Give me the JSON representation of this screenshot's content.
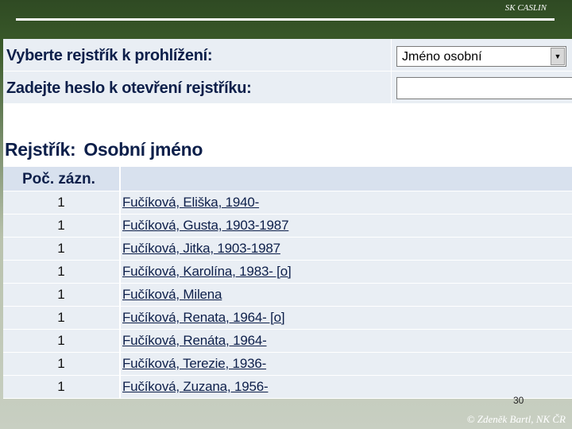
{
  "header": {
    "tag": "SK CASLIN"
  },
  "form": {
    "register_label": "Vyberte rejstřík k prohlížení:",
    "register_selected": "Jméno osobní",
    "password_label": "Zadejte heslo k otevření rejstříku:",
    "password_value": ""
  },
  "register": {
    "label": "Rejstřík:",
    "name": "Osobní jméno",
    "columns": [
      "Poč. zázn.",
      ""
    ],
    "rows": [
      {
        "count": "1",
        "name": "Fučíková, Eliška, 1940-"
      },
      {
        "count": "1",
        "name": "Fučíková, Gusta, 1903-1987"
      },
      {
        "count": "1",
        "name": "Fučíková, Jitka, 1903-1987"
      },
      {
        "count": "1",
        "name": "Fučíková, Karolína, 1983- [o]"
      },
      {
        "count": "1",
        "name": "Fučíková, Milena"
      },
      {
        "count": "1",
        "name": "Fučíková, Renata, 1964- [o]"
      },
      {
        "count": "1",
        "name": "Fučíková, Renáta, 1964-"
      },
      {
        "count": "1",
        "name": "Fučíková, Terezie, 1936-"
      },
      {
        "count": "1",
        "name": "Fučíková, Zuzana, 1956-"
      }
    ]
  },
  "footer": {
    "page_number": "30",
    "copyright": "© Zdeněk Bartl, NK ČR"
  },
  "icons": {
    "dropdown": "chevron-down-icon"
  },
  "colors": {
    "accent_text": "#0d1f4a",
    "row_bg": "#e9eef4",
    "header_bg": "#d8e1ee",
    "slide_bg": "#2f4a23"
  }
}
